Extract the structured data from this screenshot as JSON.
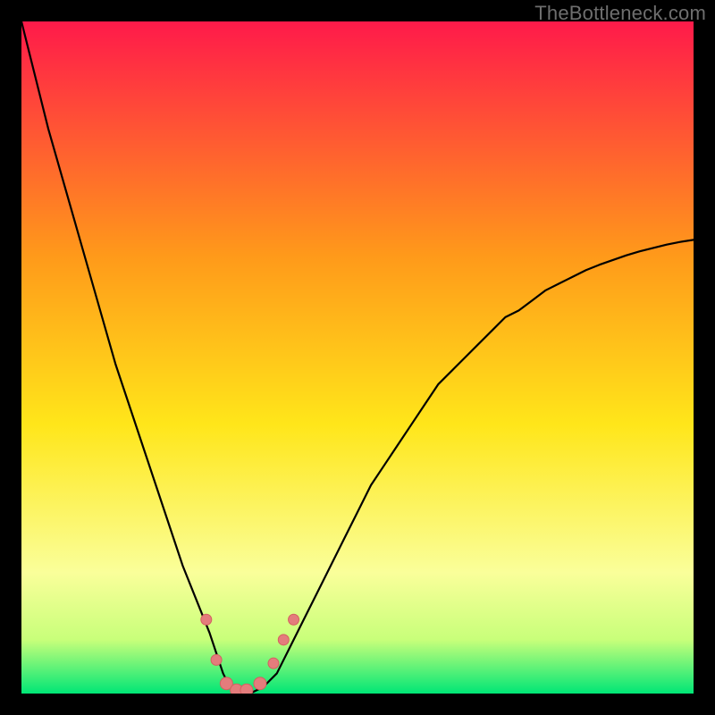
{
  "watermark": "TheBottleneck.com",
  "colors": {
    "bg": "#000000",
    "curve": "#000000",
    "marker_fill": "#e47c7c",
    "marker_stroke": "#d46060",
    "gradient_top": "#ff1a4a",
    "gradient_mid1": "#ff9a1a",
    "gradient_mid2": "#ffe61a",
    "gradient_low": "#faff9a",
    "gradient_band": "#c8ff7a",
    "gradient_bottom": "#00e676"
  },
  "chart_data": {
    "type": "line",
    "title": "",
    "xlabel": "",
    "ylabel": "",
    "xlim": [
      0,
      100
    ],
    "ylim": [
      0,
      100
    ],
    "x": [
      0,
      2,
      4,
      6,
      8,
      10,
      12,
      14,
      16,
      18,
      20,
      22,
      24,
      26,
      28,
      29,
      30,
      31,
      32,
      33,
      34,
      36,
      38,
      40,
      42,
      44,
      46,
      48,
      50,
      52,
      54,
      56,
      58,
      60,
      62,
      64,
      66,
      68,
      70,
      72,
      74,
      76,
      78,
      80,
      82,
      84,
      86,
      88,
      90,
      92,
      94,
      96,
      98,
      100
    ],
    "values": [
      100,
      92,
      84,
      77,
      70,
      63,
      56,
      49,
      43,
      37,
      31,
      25,
      19,
      14,
      9,
      6,
      3,
      1,
      0,
      0,
      0,
      1,
      3,
      7,
      11,
      15,
      19,
      23,
      27,
      31,
      34,
      37,
      40,
      43,
      46,
      48,
      50,
      52,
      54,
      56,
      57,
      58.5,
      60,
      61,
      62,
      63,
      63.8,
      64.5,
      65.2,
      65.8,
      66.3,
      66.8,
      67.2,
      67.5
    ],
    "markers": [
      {
        "x": 27.5,
        "y": 11,
        "r": 6
      },
      {
        "x": 29,
        "y": 5,
        "r": 6
      },
      {
        "x": 30.5,
        "y": 1.5,
        "r": 7
      },
      {
        "x": 32,
        "y": 0.5,
        "r": 7
      },
      {
        "x": 33.5,
        "y": 0.5,
        "r": 7
      },
      {
        "x": 35.5,
        "y": 1.5,
        "r": 7
      },
      {
        "x": 37.5,
        "y": 4.5,
        "r": 6
      },
      {
        "x": 39,
        "y": 8,
        "r": 6
      },
      {
        "x": 40.5,
        "y": 11,
        "r": 6
      }
    ]
  }
}
